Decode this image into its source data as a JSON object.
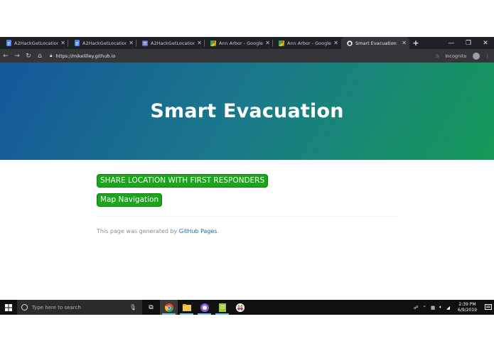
{
  "browser": {
    "tabs": [
      {
        "title": "A2HackGetLocation_Co",
        "icon": "docs-icon",
        "active": false
      },
      {
        "title": "A2HackGetLocation_Co",
        "icon": "docs-icon",
        "active": false
      },
      {
        "title": "A2HackGetLocation_Co",
        "icon": "forms-icon",
        "active": false
      },
      {
        "title": "Ann Arbor - Google Ma",
        "icon": "maps-icon",
        "active": false
      },
      {
        "title": "Ann Arbor - Google Ma",
        "icon": "maps-icon",
        "active": false
      },
      {
        "title": "Smart Evacuation",
        "icon": "github-icon",
        "active": true
      }
    ],
    "url": "https://mikelilley.github.io",
    "incognito_label": "Incognito"
  },
  "page": {
    "title": "Smart Evacuation",
    "share_button": "SHARE LOCATION WITH FIRST RESPONDERS",
    "map_button": "Map Navigation",
    "footer_prefix": "This page was generated by ",
    "footer_link": "GitHub Pages",
    "footer_suffix": "."
  },
  "taskbar": {
    "search_placeholder": "Type here to search",
    "time": "2:39 PM",
    "date": "6/9/2019",
    "notification_count": "3"
  },
  "colors": {
    "hero_start": "#155799",
    "hero_end": "#159957",
    "button_green": "#1aa51a",
    "link_blue": "#1e6bb8"
  }
}
